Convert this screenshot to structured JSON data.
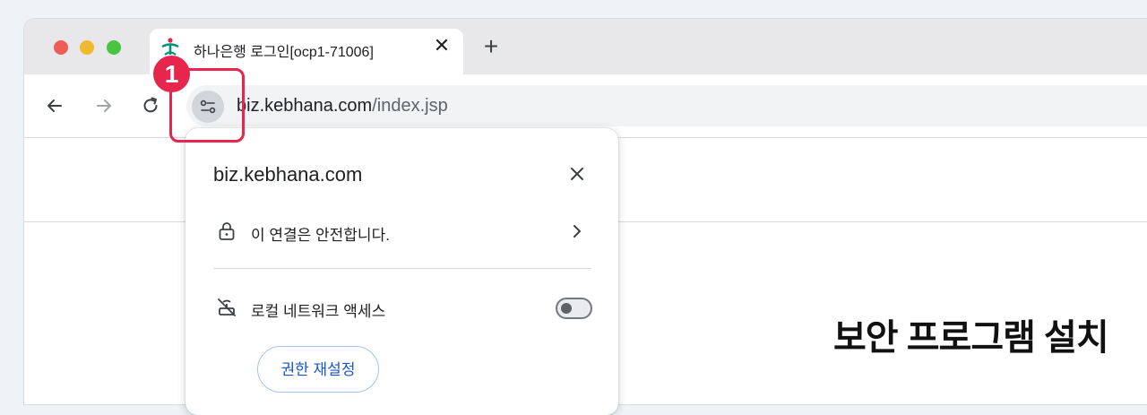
{
  "tab": {
    "title": "하나은행 로그인[ocp1-71006]",
    "close_label": "✕"
  },
  "newtab_label": "+",
  "address": {
    "domain": "biz.kebhana.com",
    "path": "/index.jsp"
  },
  "popup": {
    "title": "biz.kebhana.com",
    "connection_label": "이 연결은 안전합니다.",
    "local_network_label": "로컬 네트워크 액세스",
    "local_network_toggle_on": false,
    "reset_button_label": "권한 재설정"
  },
  "page": {
    "heading": "보안 프로그램 설치"
  },
  "annotation": {
    "step_number": "1",
    "color": "#e6264c"
  },
  "colors": {
    "traffic_red": "#ee5e57",
    "traffic_yellow": "#f1b92f",
    "traffic_green": "#47c440",
    "link_blue": "#1a56c9"
  }
}
